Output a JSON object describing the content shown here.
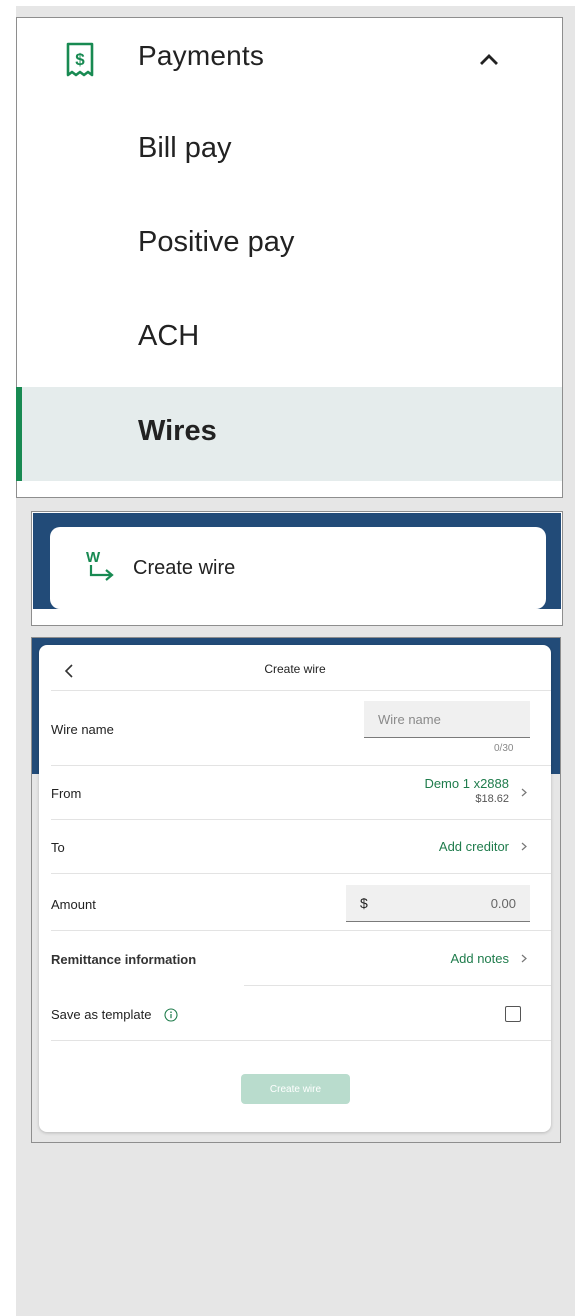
{
  "nav": {
    "title": "Payments",
    "items": [
      {
        "label": "Bill pay",
        "active": false
      },
      {
        "label": "Positive pay",
        "active": false
      },
      {
        "label": "ACH",
        "active": false
      },
      {
        "label": "Wires",
        "active": true
      }
    ],
    "icons": {
      "section": "receipt-dollar-icon",
      "toggle": "chevron-up-icon"
    }
  },
  "tile": {
    "label": "Create wire",
    "icon": "wire-transfer-icon"
  },
  "form": {
    "title": "Create wire",
    "back_icon": "chevron-left-icon",
    "wire_name": {
      "label": "Wire name",
      "placeholder": "Wire name",
      "value": "",
      "counter": "0/30"
    },
    "from": {
      "label": "From",
      "account": "Demo 1 x2888",
      "balance": "$18.62"
    },
    "to": {
      "label": "To",
      "action": "Add creditor"
    },
    "amount": {
      "label": "Amount",
      "currency": "$",
      "value": "0.00"
    },
    "remittance": {
      "label": "Remittance information",
      "action": "Add notes"
    },
    "template": {
      "label": "Save as template",
      "info_icon": "info-icon",
      "checked": false
    },
    "submit_label": "Create wire"
  },
  "colors": {
    "brand_green": "#188a52",
    "link_green": "#1f7c4c",
    "header_blue": "#224b78",
    "active_bg": "#e5ecec",
    "disabled_button": "#b9dccd",
    "backdrop": "#e6e6e6"
  }
}
